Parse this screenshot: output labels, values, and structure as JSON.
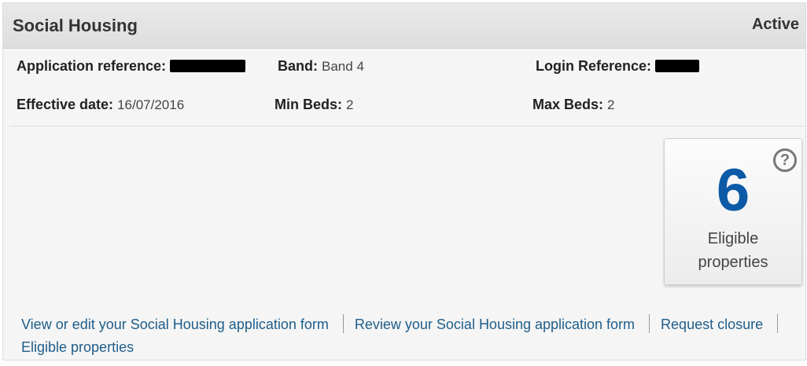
{
  "panel": {
    "title": "Social Housing",
    "status": "Active"
  },
  "details": {
    "application_reference_label": "Application reference:",
    "band_label": "Band:",
    "band_value": "Band 4",
    "login_reference_label": "Login Reference:",
    "effective_date_label": "Effective date:",
    "effective_date_value": "16/07/2016",
    "min_beds_label": "Min Beds:",
    "min_beds_value": "2",
    "max_beds_label": "Max Beds:",
    "max_beds_value": "2"
  },
  "eligible_card": {
    "count": "6",
    "label_line1": "Eligible",
    "label_line2": "properties",
    "help_symbol": "?"
  },
  "links": {
    "view_edit": "View or edit your Social Housing application form",
    "review": "Review your Social Housing application form",
    "request_closure": "Request closure",
    "eligible_properties": "Eligible properties"
  },
  "colors": {
    "accent": "#0d5aa7",
    "link": "#1f5d8a"
  },
  "icons": {
    "help": "help-circle-icon"
  }
}
